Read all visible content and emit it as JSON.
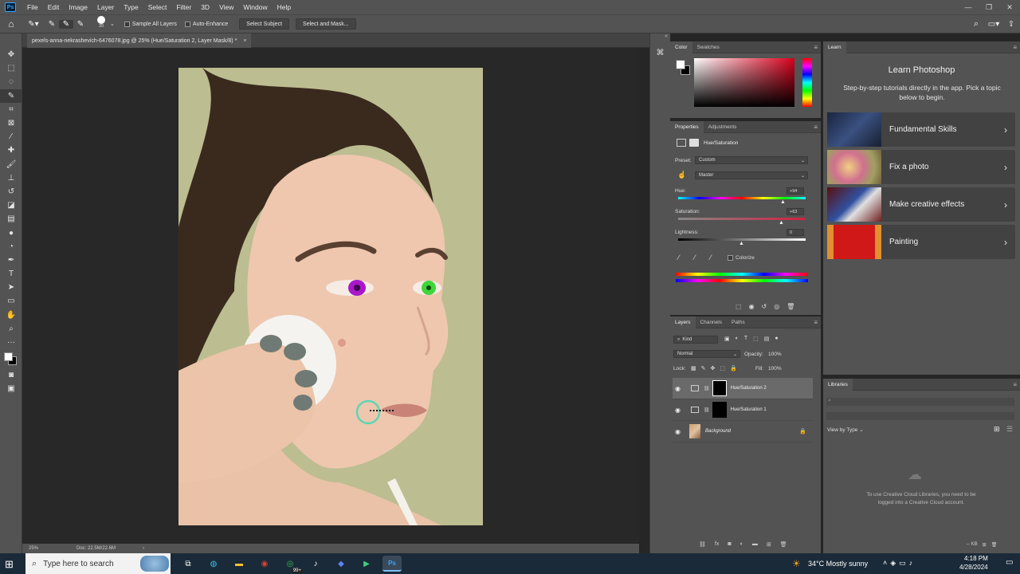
{
  "app": {
    "logo": "Ps",
    "accent": "#31a8ff"
  },
  "menu": [
    "File",
    "Edit",
    "Image",
    "Layer",
    "Type",
    "Select",
    "Filter",
    "3D",
    "View",
    "Window",
    "Help"
  ],
  "options": {
    "brush_size": "30",
    "sample_all_layers": "Sample All Layers",
    "auto_enhance": "Auto-Enhance",
    "select_subject": "Select Subject",
    "select_and_mask": "Select and Mask..."
  },
  "document": {
    "tab_title": "pexels-anna-nekrashevich-6476078.jpg @ 25% (Hue/Saturation 2, Layer Mask/8) *",
    "close": "×",
    "zoom": "25%",
    "doc_size": "Doc: 22.5M/22.6M",
    "status_arrow": "›"
  },
  "color_panel": {
    "tab_color": "Color",
    "tab_swatches": "Swatches"
  },
  "properties": {
    "tab_properties": "Properties",
    "tab_adjustments": "Adjustments",
    "adj_title": "Hue/Saturation",
    "preset_label": "Preset:",
    "preset_value": "Custom",
    "channel_value": "Master",
    "hue_label": "Hue:",
    "hue_value": "+94",
    "sat_label": "Saturation:",
    "sat_value": "+63",
    "light_label": "Lightness:",
    "light_value": "0",
    "colorize": "Colorize"
  },
  "layers_panel": {
    "tab_layers": "Layers",
    "tab_channels": "Channels",
    "tab_paths": "Paths",
    "kind": "Kind",
    "blend": "Normal",
    "opacity_label": "Opacity:",
    "opacity": "100%",
    "lock_label": "Lock:",
    "fill_label": "Fill:",
    "fill": "100%",
    "layers": [
      {
        "name": "Hue/Saturation 2"
      },
      {
        "name": "Hue/Saturation 1"
      },
      {
        "name": "Background"
      }
    ]
  },
  "learn": {
    "tab": "Learn",
    "title": "Learn Photoshop",
    "desc": "Step-by-step tutorials directly in the app. Pick a topic below to begin.",
    "items": [
      "Fundamental Skills",
      "Fix a photo",
      "Make creative effects",
      "Painting"
    ]
  },
  "libraries": {
    "tab": "Libraries",
    "view_by": "View by Type",
    "msg": "To use Creative Cloud Libraries, you need to be logged into a Creative Cloud account.",
    "footer": "-- KB"
  },
  "taskbar": {
    "search_placeholder": "Type here to search",
    "badge": "99+",
    "weather": "34°C  Mostly sunny",
    "time": "4:18 PM",
    "date": "4/28/2024"
  }
}
